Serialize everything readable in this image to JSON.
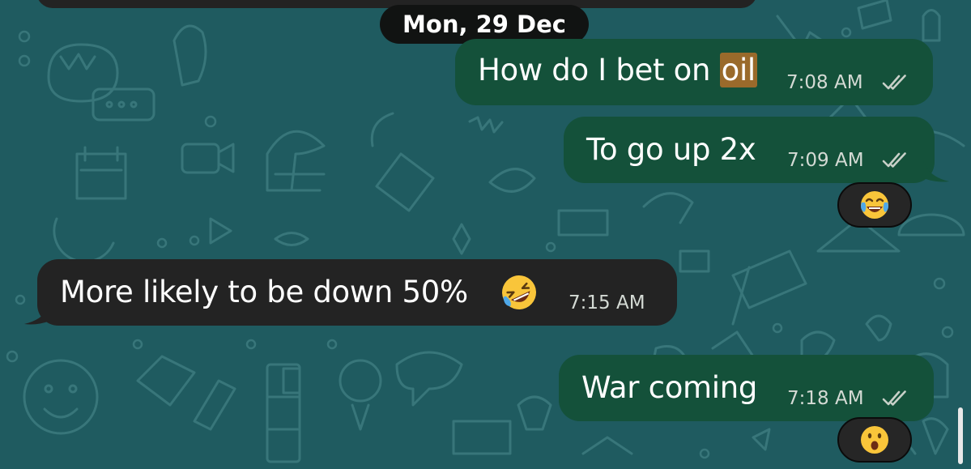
{
  "chat": {
    "date_label": "Mon, 29 Dec",
    "messages": [
      {
        "direction": "outgoing",
        "text_before": "How do I bet on ",
        "highlight": "oil",
        "time": "7:08 AM",
        "status": "read"
      },
      {
        "direction": "outgoing",
        "text": "To go up 2x",
        "time": "7:09 AM",
        "status": "read",
        "reaction": "face-with-tears-of-joy"
      },
      {
        "direction": "incoming",
        "text": "More likely to be down 50%",
        "emoji": "rolling-on-the-floor-laughing",
        "time": "7:15 AM"
      },
      {
        "direction": "outgoing",
        "text": "War coming",
        "time": "7:18 AM",
        "status": "read",
        "reaction": "face-with-open-mouth"
      }
    ]
  },
  "colors": {
    "wallpaper": "#1f5b60",
    "outgoing_bubble": "#14513a",
    "incoming_bubble": "#232323",
    "search_highlight": "#9a6a2b"
  }
}
